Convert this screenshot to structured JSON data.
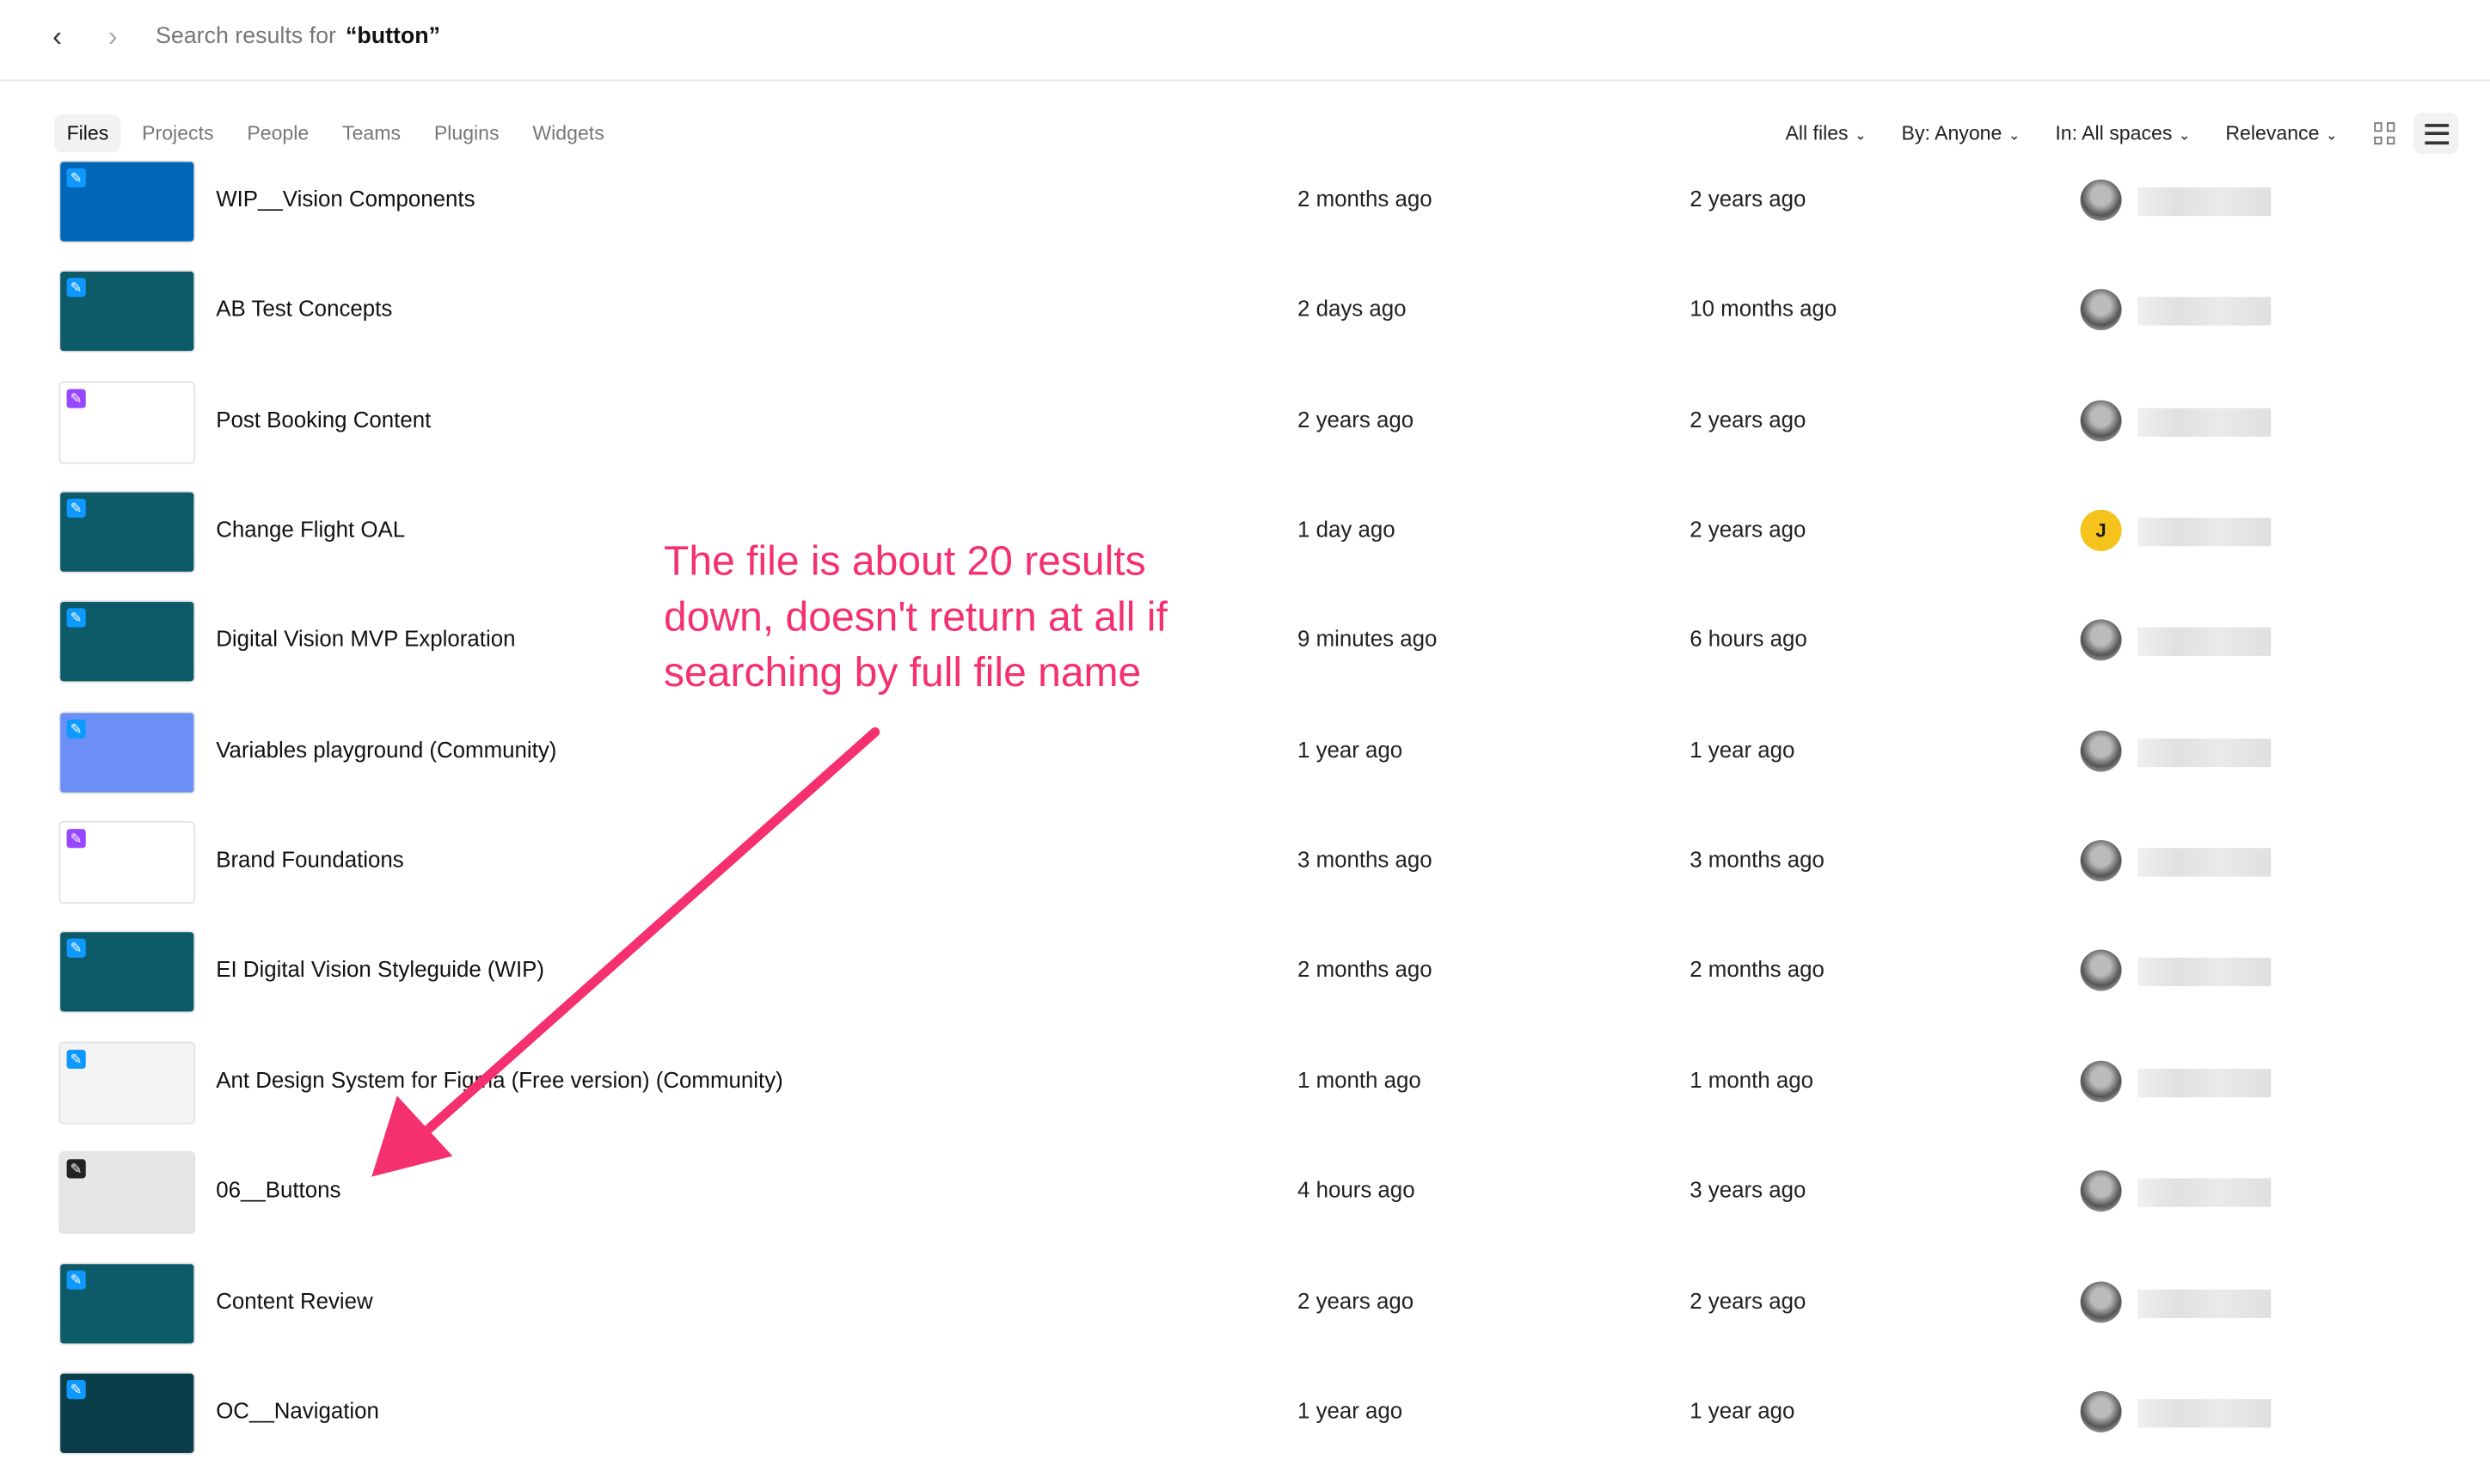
{
  "header": {
    "search_prefix": "Search results for",
    "query": "“button”",
    "back_icon": "chevron-left-icon",
    "forward_icon": "chevron-right-icon"
  },
  "tabs": [
    {
      "label": "Files",
      "active": true
    },
    {
      "label": "Projects"
    },
    {
      "label": "People"
    },
    {
      "label": "Teams"
    },
    {
      "label": "Plugins"
    },
    {
      "label": "Widgets"
    }
  ],
  "filters": [
    {
      "label": "All files"
    },
    {
      "label": "By: Anyone"
    },
    {
      "label": "In: All spaces"
    },
    {
      "label": "Relevance"
    }
  ],
  "view": {
    "grid_icon": "grid-view-icon",
    "list_icon": "list-view-icon",
    "active": "list"
  },
  "files": [
    {
      "name": "WIP__Vision Components",
      "edited": "2 months ago",
      "created": "2 years ago",
      "thumb": "#0066b8",
      "avatar": "#888"
    },
    {
      "name": "AB Test Concepts",
      "edited": "2 days ago",
      "created": "10 months ago",
      "thumb": "#0d5b69",
      "avatar": "#c99a78"
    },
    {
      "name": "Post Booking Content",
      "edited": "2 years ago",
      "created": "2 years ago",
      "thumb": "#ffffff",
      "avatar": "#7a4a3a"
    },
    {
      "name": "Change Flight OAL",
      "edited": "1 day ago",
      "created": "2 years ago",
      "thumb": "#0d5b69",
      "avatar": "#f6c31c",
      "initial": "J"
    },
    {
      "name": "Digital Vision MVP Exploration",
      "edited": "9 minutes ago",
      "created": "6 hours ago",
      "thumb": "#0d5b69",
      "avatar": "#888"
    },
    {
      "name": "Variables playground (Community)",
      "edited": "1 year ago",
      "created": "1 year ago",
      "thumb": "#6b8ff5",
      "avatar": "#888"
    },
    {
      "name": "Brand Foundations",
      "edited": "3 months ago",
      "created": "3 months ago",
      "thumb": "#ffffff",
      "avatar": "#888"
    },
    {
      "name": "EI Digital Vision Styleguide (WIP)",
      "edited": "2 months ago",
      "created": "2 months ago",
      "thumb": "#0d5b69",
      "avatar": "#888"
    },
    {
      "name": "Ant Design System for Figma (Free version) (Community)",
      "edited": "1 month ago",
      "created": "1 month ago",
      "thumb": "#f4f4f4",
      "avatar": "#888"
    },
    {
      "name": "06__Buttons",
      "edited": "4 hours ago",
      "created": "3 years ago",
      "thumb": "#e6e6e6",
      "avatar": "#888"
    },
    {
      "name": "Content Review",
      "edited": "2 years ago",
      "created": "2 years ago",
      "thumb": "#0d5b69",
      "avatar": "#888"
    },
    {
      "name": "OC__Navigation",
      "edited": "1 year ago",
      "created": "1 year ago",
      "thumb": "#0a3f4a",
      "avatar": "#888"
    }
  ],
  "annotation": {
    "text": "The file is about 20 results down, doesn't return at all if searching by full file name",
    "color": "#f4306f"
  }
}
